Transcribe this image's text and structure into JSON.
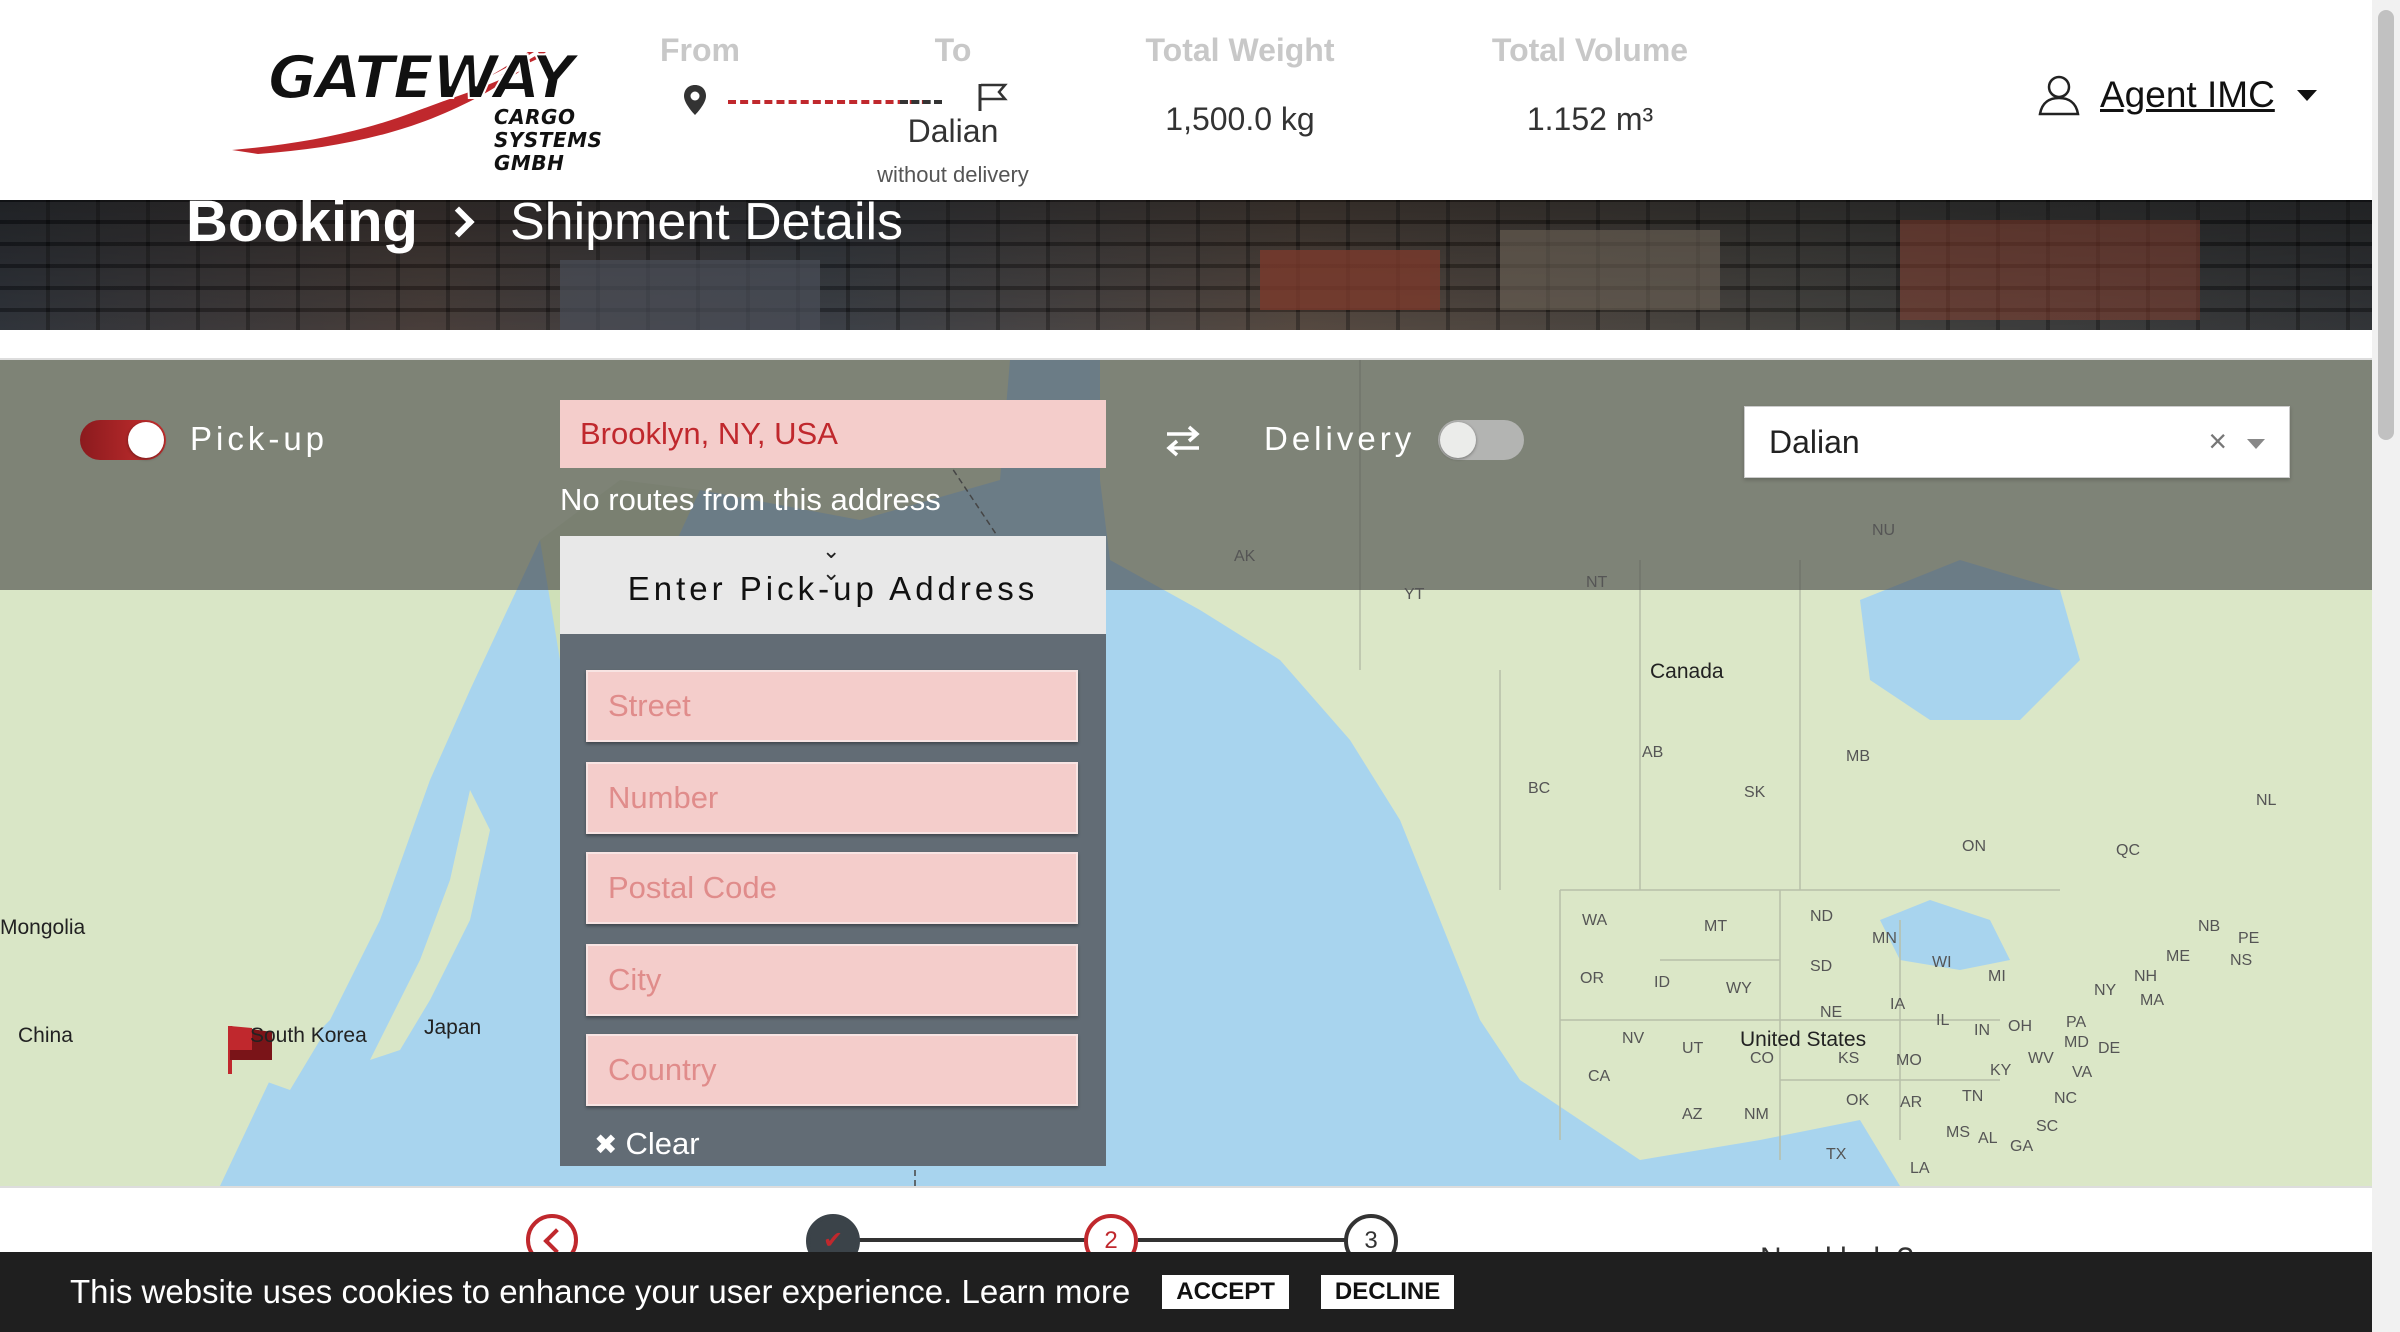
{
  "header": {
    "brand_wordmark": "GATEWAY",
    "brand_sub_line1": "CARGO",
    "brand_sub_line2": "SYSTEMS GMBH",
    "from_label": "From",
    "to_label": "To",
    "to_value": "Dalian",
    "to_sub": "without delivery",
    "weight_label": "Total Weight",
    "weight_value": "1,500.0 kg",
    "volume_label": "Total Volume",
    "volume_value": "1.152 m³",
    "agent_name": "Agent IMC"
  },
  "breadcrumb": {
    "root": "Booking",
    "current": "Shipment Details"
  },
  "controls": {
    "pickup_label": "Pick-up",
    "pickup_enabled": true,
    "pickup_address": "Brooklyn, NY, USA",
    "no_routes_msg": "No routes from this address",
    "delivery_label": "Delivery",
    "delivery_enabled": false,
    "destination_value": "Dalian"
  },
  "pickup_panel": {
    "title": "Enter Pick-up Address",
    "street_placeholder": "Street",
    "number_placeholder": "Number",
    "postal_placeholder": "Postal Code",
    "city_placeholder": "City",
    "country_placeholder": "Country",
    "clear_label": "Clear"
  },
  "map": {
    "labels": {
      "mongolia": "Mongolia",
      "china": "China",
      "south_korea": "South Korea",
      "japan": "Japan",
      "canada": "Canada",
      "united_states": "United States",
      "ak": "AK",
      "yt": "YT",
      "nt": "NT",
      "nu": "NU",
      "bc": "BC",
      "ab": "AB",
      "sk": "SK",
      "mb": "MB",
      "on": "ON",
      "qc": "QC",
      "nl": "NL",
      "nb": "NB",
      "pe": "PE",
      "ns": "NS",
      "wa": "WA",
      "or": "OR",
      "id": "ID",
      "mt": "MT",
      "wy": "WY",
      "nv": "NV",
      "ut": "UT",
      "co": "CO",
      "ca": "CA",
      "az": "AZ",
      "nm": "NM",
      "nd": "ND",
      "sd": "SD",
      "ne": "NE",
      "ks": "KS",
      "ok": "OK",
      "tx": "TX",
      "mn": "MN",
      "ia": "IA",
      "mo": "MO",
      "ar": "AR",
      "la": "LA",
      "wi": "WI",
      "il": "IL",
      "mi": "MI",
      "in": "IN",
      "oh": "OH",
      "ky": "KY",
      "tn": "TN",
      "ms": "MS",
      "al": "AL",
      "ga": "GA",
      "sc": "SC",
      "nc": "NC",
      "va": "VA",
      "wv": "WV",
      "pa": "PA",
      "ny": "NY",
      "md": "MD",
      "de": "DE",
      "nh": "NH",
      "ma": "MA",
      "me": "ME"
    }
  },
  "stepper": {
    "step1": "✔",
    "step2": "2",
    "step3": "3",
    "need_help": "Need help?"
  },
  "cookie": {
    "message": "This website uses cookies to enhance your user experience. Learn more",
    "accept": "ACCEPT",
    "decline": "DECLINE"
  },
  "colors": {
    "brand_red": "#c0282d",
    "input_pink": "#f4cdcb",
    "panel_slate": "#626c75",
    "water": "#a8d4ee",
    "land": "#d9e6c6"
  }
}
